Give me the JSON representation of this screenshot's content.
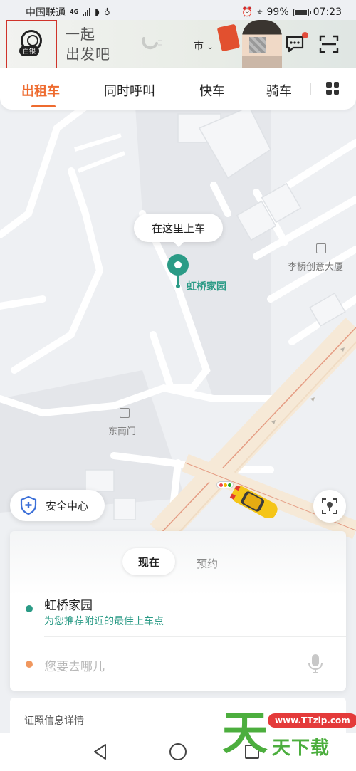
{
  "status_bar": {
    "carrier": "中国联通",
    "network": "4G",
    "battery": "99%",
    "battery_level": 0.99,
    "time": "07:23"
  },
  "header": {
    "member_badge": "白银",
    "slogan_line1": "一起",
    "slogan_line2": "出发吧",
    "city": "市",
    "icons": [
      "user-avatar-icon",
      "didi-logo-icon",
      "chevron-down-icon",
      "message-icon",
      "scan-icon"
    ]
  },
  "tabs": {
    "items": [
      {
        "label": "出租车",
        "active": true
      },
      {
        "label": "同时呼叫",
        "active": false
      },
      {
        "label": "快车",
        "active": false
      },
      {
        "label": "骑车",
        "active": false
      }
    ],
    "more_icon": "grid-icon"
  },
  "map": {
    "pickup_prompt": "在这里上车",
    "pickup_place": "虹桥家园",
    "poi_building": "李桥创意大厦",
    "poi_gate": "东南门"
  },
  "safety": {
    "label": "安全中心"
  },
  "booking": {
    "mode_now": "现在",
    "mode_later": "预约",
    "from_name": "虹桥家园",
    "from_hint": "为您推荐附近的最佳上车点",
    "to_placeholder": "您要去哪儿",
    "colors": {
      "accent": "#ee6b2f",
      "start_dot": "#2b9b86",
      "end_dot": "#f0975e"
    }
  },
  "cert": {
    "label": "证照信息详情"
  },
  "watermark": {
    "url": "www.TTzip.com",
    "char_big": "天",
    "text": "天下载"
  }
}
